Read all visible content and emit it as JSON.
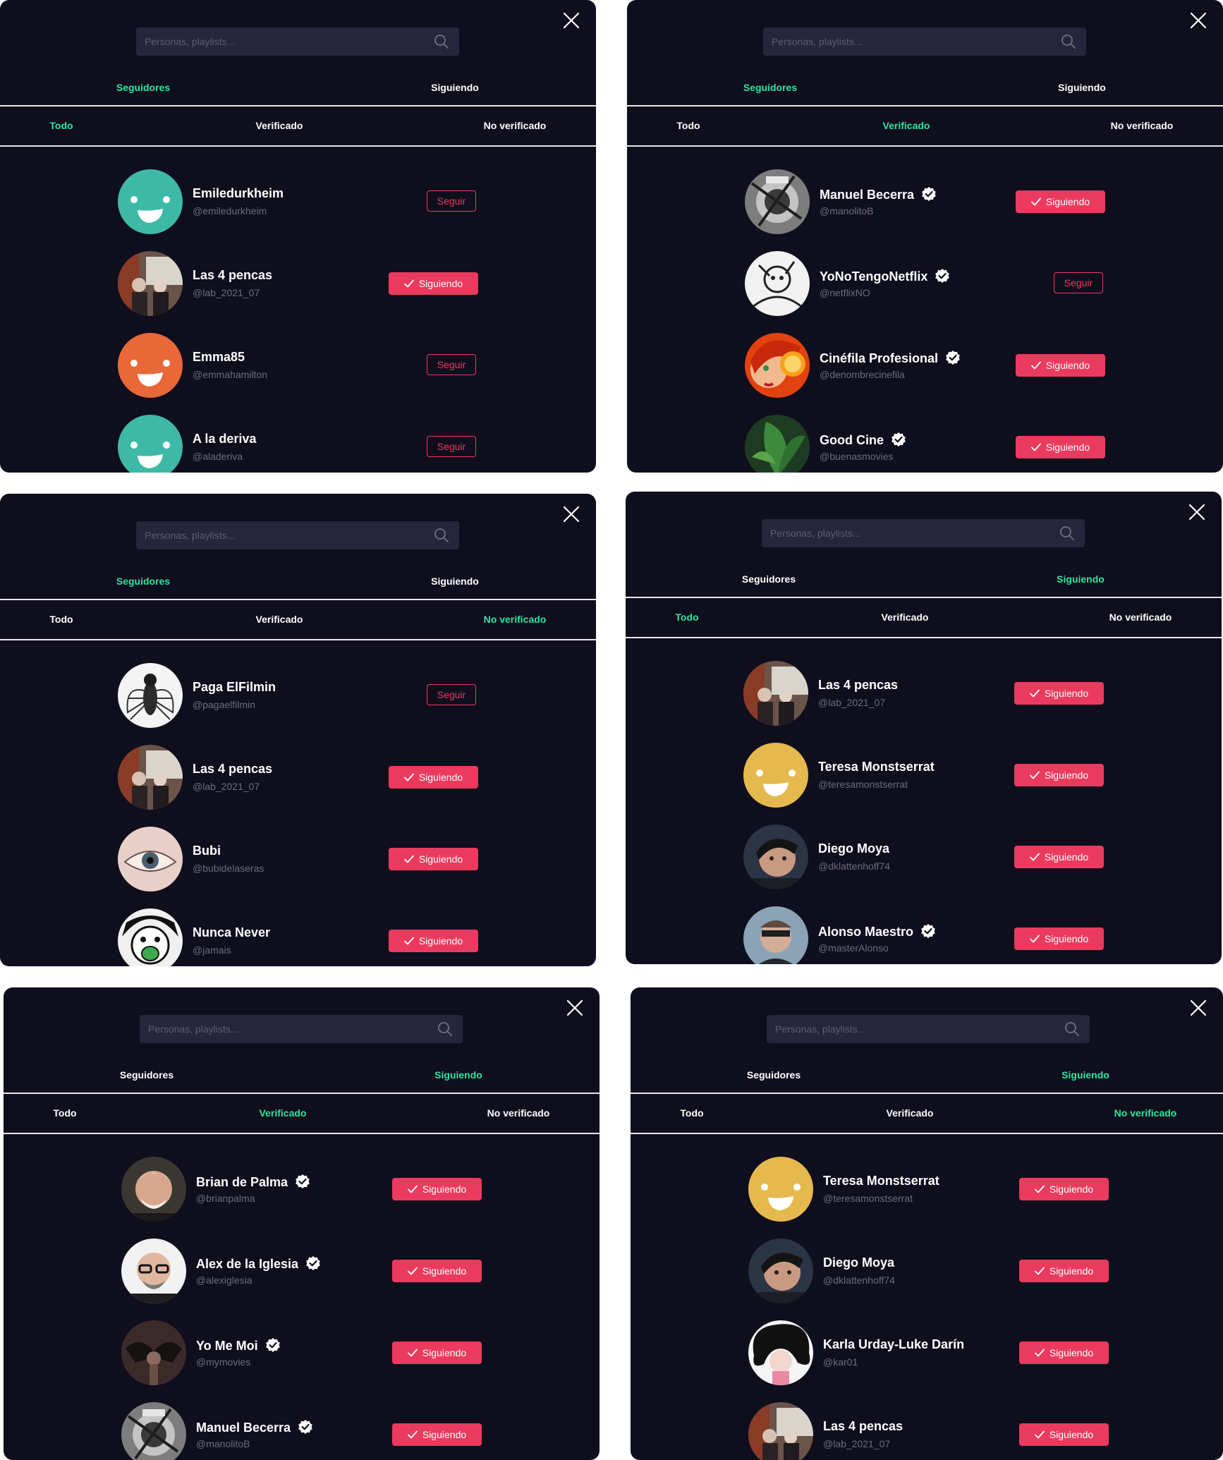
{
  "search_placeholder": "Personas, playlists...",
  "colors": {
    "panel_bg": "#0f0e1d",
    "accent_green": "#2ee5a0",
    "accent_red": "#ea3b5f"
  },
  "panels": [
    {
      "tab_top": [
        "Seguidores",
        "Siguiendo"
      ],
      "active_top": 0,
      "tab_sub": [
        "Todo",
        "Verificado",
        "No verificado"
      ],
      "active_sub": 0,
      "users": [
        {
          "name": "Emiledurkheim",
          "handle": "@emiledurkheim",
          "verified": false,
          "following": false,
          "button": "Seguir",
          "avatar": "smiley-teal"
        },
        {
          "name": "Las 4 pencas",
          "handle": "@lab_2021_07",
          "verified": false,
          "following": true,
          "button": "Siguiendo",
          "avatar": "photo-group"
        },
        {
          "name": "Emma85",
          "handle": "@emmahamilton",
          "verified": false,
          "following": false,
          "button": "Seguir",
          "avatar": "smiley-orange"
        },
        {
          "name": "A la deriva",
          "handle": "@aladeriva",
          "verified": false,
          "following": false,
          "button": "Seguir",
          "avatar": "smiley-teal"
        }
      ]
    },
    {
      "tab_top": [
        "Seguidores",
        "Siguiendo"
      ],
      "active_top": 0,
      "tab_sub": [
        "Todo",
        "Verificado",
        "No verificado"
      ],
      "active_sub": 1,
      "users": [
        {
          "name": "Manuel Becerra",
          "handle": "@manolitoB",
          "verified": true,
          "following": true,
          "button": "Siguiendo",
          "avatar": "photo-escher"
        },
        {
          "name": "YoNoTengoNetflix",
          "handle": "@netflixNO",
          "verified": true,
          "following": false,
          "button": "Seguir",
          "avatar": "photo-sketch"
        },
        {
          "name": "Cinéfila Profesional",
          "handle": "@denombrecinefila",
          "verified": true,
          "following": true,
          "button": "Siguiendo",
          "avatar": "photo-orange"
        },
        {
          "name": "Good Cine",
          "handle": "@buenasmovies",
          "verified": true,
          "following": true,
          "button": "Siguiendo",
          "avatar": "photo-plant"
        }
      ]
    },
    {
      "tab_top": [
        "Seguidores",
        "Siguiendo"
      ],
      "active_top": 0,
      "tab_sub": [
        "Todo",
        "Verificado",
        "No verificado"
      ],
      "active_sub": 2,
      "users": [
        {
          "name": "Paga ElFilmin",
          "handle": "@pagaelfilmin",
          "verified": false,
          "following": false,
          "button": "Seguir",
          "avatar": "photo-fly"
        },
        {
          "name": "Las 4 pencas",
          "handle": "@lab_2021_07",
          "verified": false,
          "following": true,
          "button": "Siguiendo",
          "avatar": "photo-group"
        },
        {
          "name": "Bubi",
          "handle": "@bubidelaseras",
          "verified": false,
          "following": true,
          "button": "Siguiendo",
          "avatar": "photo-eye"
        },
        {
          "name": "Nunca Never",
          "handle": "@jamais",
          "verified": false,
          "following": true,
          "button": "Siguiendo",
          "avatar": "photo-manga"
        }
      ]
    },
    {
      "tab_top": [
        "Seguidores",
        "Siguiendo"
      ],
      "active_top": 1,
      "tab_sub": [
        "Todo",
        "Verificado",
        "No verificado"
      ],
      "active_sub": 0,
      "users": [
        {
          "name": "Las 4 pencas",
          "handle": "@lab_2021_07",
          "verified": false,
          "following": true,
          "button": "Siguiendo",
          "avatar": "photo-group"
        },
        {
          "name": "Teresa Monstserrat",
          "handle": "@teresamonstserrat",
          "verified": false,
          "following": true,
          "button": "Siguiendo",
          "avatar": "smiley-yellow"
        },
        {
          "name": "Diego Moya",
          "handle": "@dklattenhoff74",
          "verified": false,
          "following": true,
          "button": "Siguiendo",
          "avatar": "photo-man"
        },
        {
          "name": "Alonso Maestro",
          "handle": "@masterAlonso",
          "verified": true,
          "following": true,
          "button": "Siguiendo",
          "avatar": "photo-man2"
        }
      ]
    },
    {
      "tab_top": [
        "Seguidores",
        "Siguiendo"
      ],
      "active_top": 1,
      "tab_sub": [
        "Todo",
        "Verificado",
        "No verificado"
      ],
      "active_sub": 1,
      "users": [
        {
          "name": "Brian de Palma",
          "handle": "@brianpalma",
          "verified": true,
          "following": true,
          "button": "Siguiendo",
          "avatar": "photo-old"
        },
        {
          "name": "Alex de la Iglesia",
          "handle": "@alexiglesia",
          "verified": true,
          "following": true,
          "button": "Siguiendo",
          "avatar": "photo-glasses"
        },
        {
          "name": "Yo Me Moi",
          "handle": "@mymovies",
          "verified": true,
          "following": true,
          "button": "Siguiendo",
          "avatar": "photo-bat"
        },
        {
          "name": "Manuel Becerra",
          "handle": "@manolitoB",
          "verified": true,
          "following": true,
          "button": "Siguiendo",
          "avatar": "photo-escher"
        }
      ]
    },
    {
      "tab_top": [
        "Seguidores",
        "Siguiendo"
      ],
      "active_top": 1,
      "tab_sub": [
        "Todo",
        "Verificado",
        "No verificado"
      ],
      "active_sub": 2,
      "users": [
        {
          "name": "Teresa Monstserrat",
          "handle": "@teresamonstserrat",
          "verified": false,
          "following": true,
          "button": "Siguiendo",
          "avatar": "smiley-yellow"
        },
        {
          "name": "Diego Moya",
          "handle": "@dklattenhoff74",
          "verified": false,
          "following": true,
          "button": "Siguiendo",
          "avatar": "photo-man"
        },
        {
          "name": "Karla Urday-Luke Darín",
          "handle": "@kar01",
          "verified": false,
          "following": true,
          "button": "Siguiendo",
          "avatar": "photo-hair"
        },
        {
          "name": "Las 4 pencas",
          "handle": "@lab_2021_07",
          "verified": false,
          "following": true,
          "button": "Siguiendo",
          "avatar": "photo-group"
        }
      ]
    }
  ]
}
